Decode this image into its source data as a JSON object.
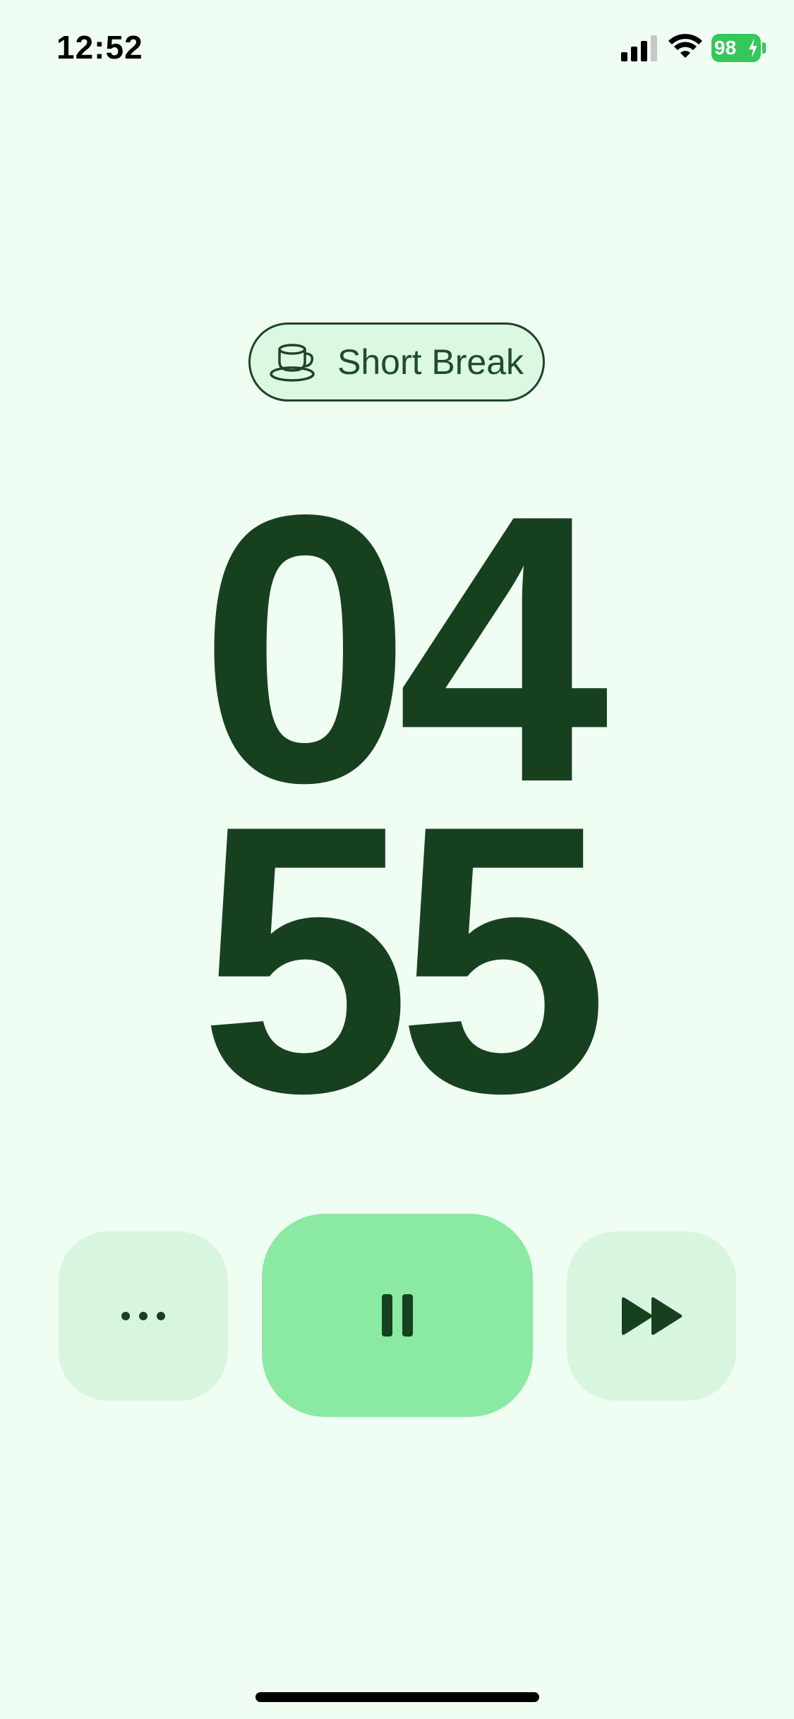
{
  "status_bar": {
    "time": "12:52",
    "battery_level": "98",
    "signal_icon": "cellular-signal-icon",
    "wifi_icon": "wifi-icon",
    "battery_icon": "battery-charging-icon",
    "battery_color": "#34c759"
  },
  "mode": {
    "label": "Short Break",
    "icon": "coffee-cup-icon"
  },
  "timer": {
    "minutes": "04",
    "seconds": "55"
  },
  "controls": {
    "more_icon": "ellipsis-icon",
    "play_pause_icon": "pause-icon",
    "skip_icon": "fast-forward-icon"
  },
  "colors": {
    "background": "#f0fdf3",
    "accent": "#8ae9a2",
    "secondary": "#d8f6df",
    "text": "#17401f"
  }
}
